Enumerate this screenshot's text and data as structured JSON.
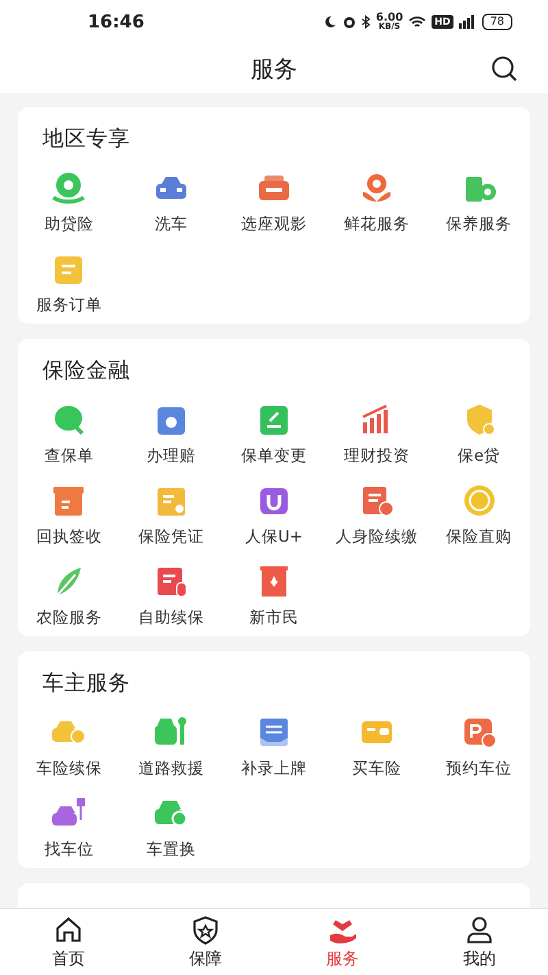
{
  "status_bar": {
    "time": "16:46",
    "speed_value": "6.00",
    "speed_unit": "KB/S",
    "hd": "HD",
    "battery": "78"
  },
  "header": {
    "title": "服务"
  },
  "sections": [
    {
      "title": "地区专享",
      "items": [
        {
          "label": "助贷险"
        },
        {
          "label": "洗车"
        },
        {
          "label": "选座观影"
        },
        {
          "label": "鲜花服务"
        },
        {
          "label": "保养服务"
        },
        {
          "label": "服务订单"
        }
      ]
    },
    {
      "title": "保险金融",
      "items": [
        {
          "label": "查保单"
        },
        {
          "label": "办理赔"
        },
        {
          "label": "保单变更"
        },
        {
          "label": "理财投资"
        },
        {
          "label": "保e贷"
        },
        {
          "label": "回执签收"
        },
        {
          "label": "保险凭证"
        },
        {
          "label": "人保U+"
        },
        {
          "label": "人身险续缴"
        },
        {
          "label": "保险直购"
        },
        {
          "label": "农险服务"
        },
        {
          "label": "自助续保"
        },
        {
          "label": "新市民"
        }
      ]
    },
    {
      "title": "车主服务",
      "items": [
        {
          "label": "车险续保"
        },
        {
          "label": "道路救援"
        },
        {
          "label": "补录上牌"
        },
        {
          "label": "买车险"
        },
        {
          "label": "预约车位"
        },
        {
          "label": "找车位"
        },
        {
          "label": "车置换"
        }
      ]
    }
  ],
  "tabs": [
    {
      "label": "首页",
      "selected": false
    },
    {
      "label": "保障",
      "selected": false
    },
    {
      "label": "服务",
      "selected": true
    },
    {
      "label": "我的",
      "selected": false
    }
  ]
}
